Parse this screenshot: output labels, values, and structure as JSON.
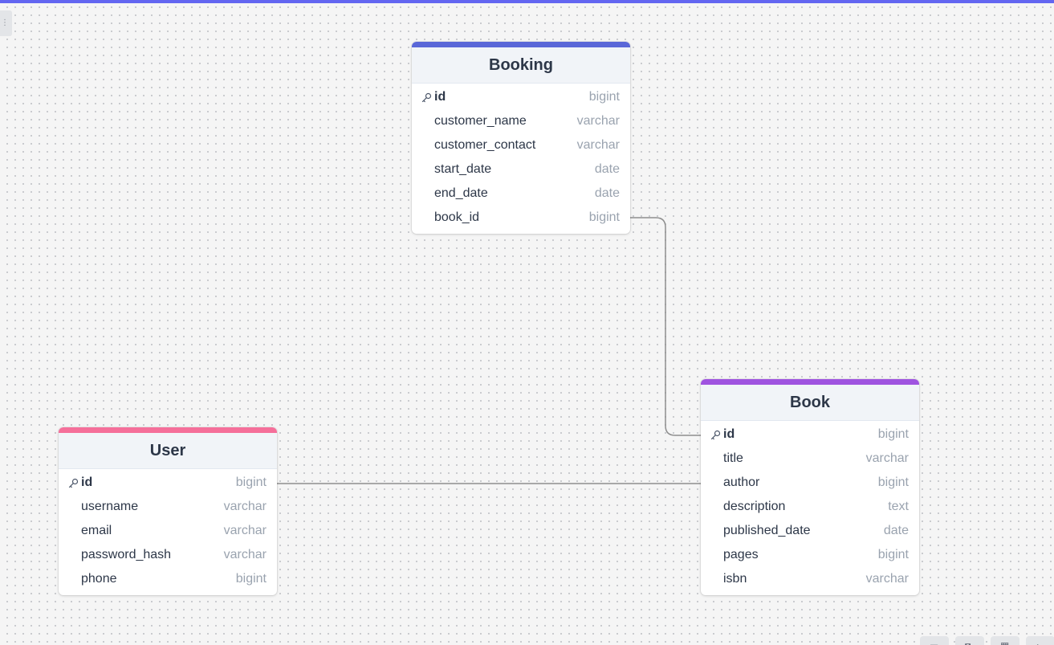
{
  "colors": {
    "accent_top": "#6366f1",
    "booking_accent": "#5a67d8",
    "book_accent": "#9f53e0",
    "user_accent": "#f56f9a",
    "edge": "#8e8e8e"
  },
  "tables": {
    "booking": {
      "name": "Booking",
      "fields": [
        {
          "name": "id",
          "type": "bigint",
          "pk": true
        },
        {
          "name": "customer_name",
          "type": "varchar"
        },
        {
          "name": "customer_contact",
          "type": "varchar"
        },
        {
          "name": "start_date",
          "type": "date"
        },
        {
          "name": "end_date",
          "type": "date"
        },
        {
          "name": "book_id",
          "type": "bigint"
        }
      ]
    },
    "book": {
      "name": "Book",
      "fields": [
        {
          "name": "id",
          "type": "bigint",
          "pk": true
        },
        {
          "name": "title",
          "type": "varchar"
        },
        {
          "name": "author",
          "type": "bigint"
        },
        {
          "name": "description",
          "type": "text"
        },
        {
          "name": "published_date",
          "type": "date"
        },
        {
          "name": "pages",
          "type": "bigint"
        },
        {
          "name": "isbn",
          "type": "varchar"
        }
      ]
    },
    "user": {
      "name": "User",
      "fields": [
        {
          "name": "id",
          "type": "bigint",
          "pk": true
        },
        {
          "name": "username",
          "type": "varchar"
        },
        {
          "name": "email",
          "type": "varchar"
        },
        {
          "name": "password_hash",
          "type": "varchar"
        },
        {
          "name": "phone",
          "type": "bigint"
        }
      ]
    }
  },
  "relationships": [
    {
      "from": "Booking.book_id",
      "to": "Book.id"
    },
    {
      "from": "User.id",
      "to": "Book.author"
    }
  ],
  "icons": {
    "primary_key": "key-icon",
    "sidebar_toggle": "grip-icon",
    "controls": [
      "fit-view-icon",
      "lock-icon",
      "layout-icon",
      "collapse-icon"
    ]
  }
}
